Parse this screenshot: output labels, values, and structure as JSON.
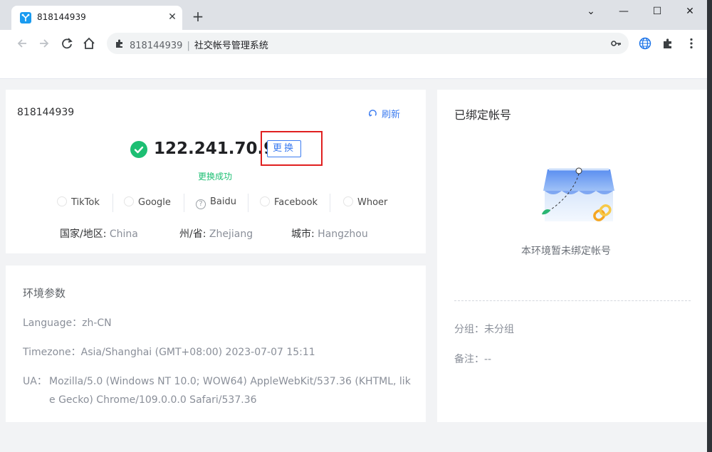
{
  "browser": {
    "tab_title": "818144939",
    "tab_close": "✕",
    "new_tab": "+",
    "window_controls": {
      "minimize": "—",
      "maximize": "☐",
      "close": "✕",
      "menu": "⌄"
    },
    "url_host": "818144939",
    "url_separator": "|",
    "url_title": "社交帐号管理系统"
  },
  "ip_card": {
    "id": "818144939",
    "refresh_label": "刷新",
    "ip": "122.241.70.98",
    "change_label": "更换",
    "status": "更换成功",
    "status_color": "#1dbf73",
    "check_links": [
      {
        "label": "TikTok",
        "icon": "circle-icon"
      },
      {
        "label": "Google",
        "icon": "circle-icon"
      },
      {
        "label": "Baidu",
        "icon": "question-icon"
      },
      {
        "label": "Facebook",
        "icon": "circle-icon"
      },
      {
        "label": "Whoer",
        "icon": "circle-icon"
      }
    ],
    "geo": {
      "country_label": "国家/地区:",
      "country": "China",
      "province_label": "州/省:",
      "province": "Zhejiang",
      "city_label": "城市:",
      "city": "Hangzhou"
    }
  },
  "env_card": {
    "title": "环境参数",
    "language_label": "Language：",
    "language": "zh-CN",
    "timezone_label": "Timezone：",
    "timezone": "Asia/Shanghai (GMT+08:00) 2023-07-07 15:11",
    "ua_label": "UA：",
    "ua": "Mozilla/5.0 (Windows NT 10.0; WOW64) AppleWebKit/537.36 (KHTML, like Gecko) Chrome/109.0.0.0 Safari/537.36"
  },
  "bind_card": {
    "title": "已绑定帐号",
    "empty_text": "本环境暂未绑定帐号",
    "group_label": "分组：",
    "group": "未分组",
    "note_label": "备注：",
    "note": "--"
  },
  "colors": {
    "accent": "#3c7cf0",
    "highlight": "#e02020",
    "success": "#1dbf73"
  }
}
